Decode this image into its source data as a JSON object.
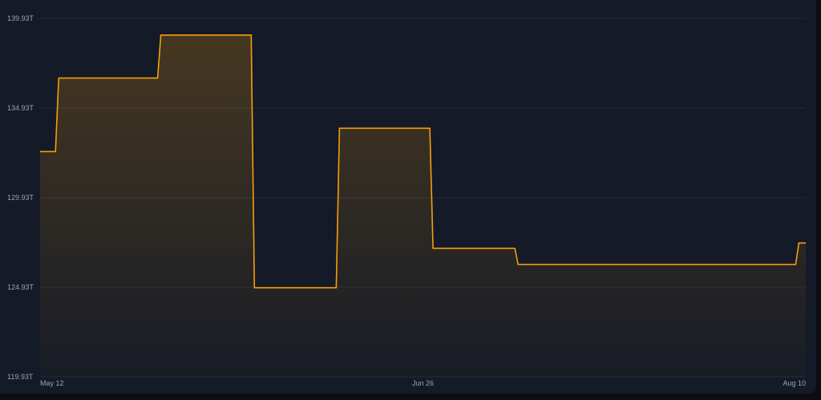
{
  "chart_data": {
    "type": "area",
    "step": true,
    "title": "",
    "xlabel": "",
    "ylabel": "",
    "y_unit": "T",
    "ylim": [
      119.93,
      139.93
    ],
    "grid": "horizontal",
    "y_ticks": [
      "119.93T",
      "124.93T",
      "129.93T",
      "134.93T",
      "139.93T"
    ],
    "y_tick_values": [
      119.93,
      124.93,
      129.93,
      134.93,
      139.93
    ],
    "x_ticks": [
      "May 12",
      "Jun 26",
      "Aug 10"
    ],
    "x_tick_values": [
      "2024-05-12",
      "2024-06-26",
      "2024-08-10"
    ],
    "x": [
      "2024-05-12",
      "2024-05-14",
      "2024-05-26",
      "2024-06-06",
      "2024-06-16",
      "2024-06-27",
      "2024-07-07",
      "2024-07-17",
      "2024-08-09",
      "2024-08-10"
    ],
    "values": [
      132.5,
      136.6,
      139.0,
      124.9,
      133.8,
      127.1,
      126.2,
      126.2,
      127.4,
      127.4
    ],
    "line_color": "#f59e0b",
    "fill_color": "#f59e0b",
    "background_color": "#141a27"
  }
}
